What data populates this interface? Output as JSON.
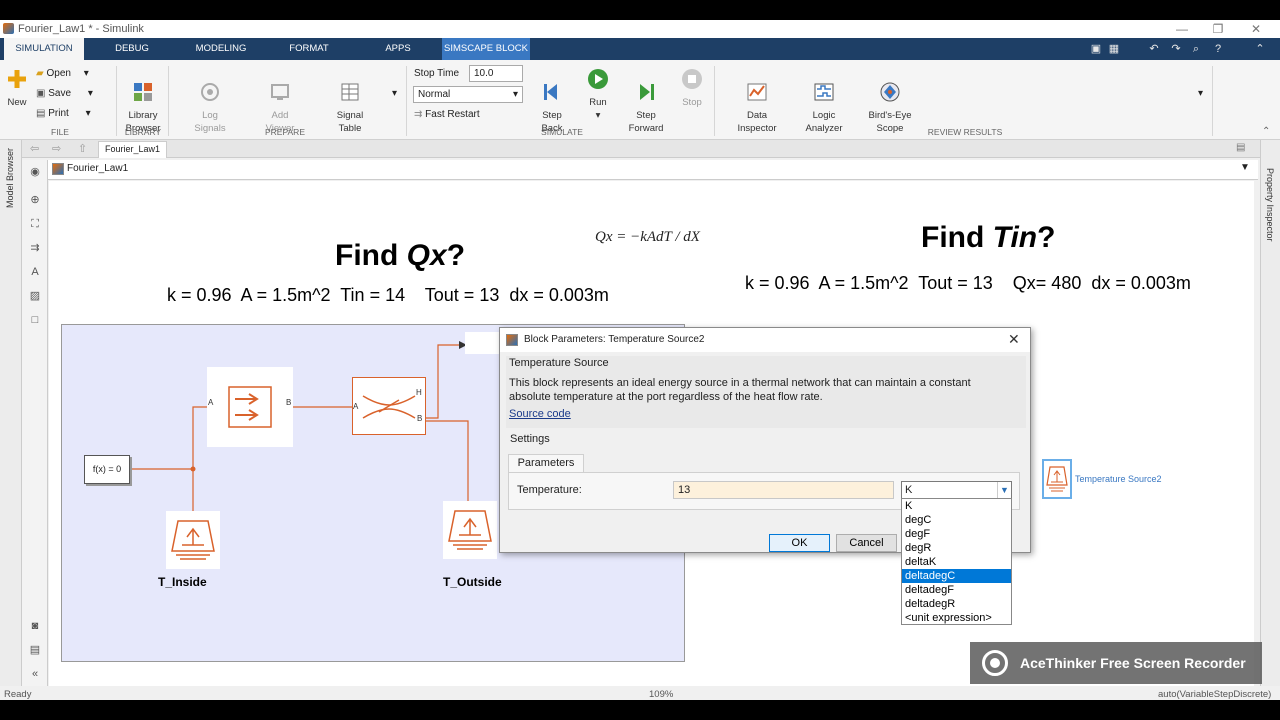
{
  "window": {
    "title": "Fourier_Law1 * - Simulink",
    "controls": [
      "—",
      "❐",
      "✕"
    ]
  },
  "ribbon_tabs": [
    "SIMULATION",
    "DEBUG",
    "MODELING",
    "FORMAT",
    "APPS",
    "SIMSCAPE BLOCK"
  ],
  "ribbon": {
    "file": {
      "title": "FILE",
      "new_label": "New",
      "open_label": "Open",
      "save_label": "Save",
      "print_label": "Print"
    },
    "library": {
      "title": "LIBRARY",
      "library_browser_label": "Library\nBrowser"
    },
    "prepare": {
      "title": "PREPARE",
      "log_signals_label": "Log\nSignals",
      "add_viewer_label": "Add\nViewer",
      "signal_table_label": "Signal\nTable"
    },
    "simulate": {
      "title": "SIMULATE",
      "stop_time_label": "Stop Time",
      "stop_time_value": "10.0",
      "mode_value": "Normal",
      "fast_restart_label": "Fast Restart",
      "step_back_label": "Step\nBack",
      "run_label": "Run",
      "step_forward_label": "Step\nForward",
      "stop_label": "Stop"
    },
    "review": {
      "title": "REVIEW RESULTS",
      "data_inspector_label": "Data\nInspector",
      "logic_analyzer_label": "Logic\nAnalyzer",
      "birds_eye_label": "Bird's-Eye\nScope"
    }
  },
  "editor": {
    "tab_label": "Fourier_Law1",
    "address": "Fourier_Law1",
    "left_strip_label": "Model Browser",
    "right_strip_label": "Property Inspector"
  },
  "canvas": {
    "left_title_prefix": "Find ",
    "left_title_italic": "Qx",
    "left_title_suffix": "?",
    "left_params": "k = 0.96  A = 1.5m^2  Tin = 14    Tout = 13  dx = 0.003m",
    "equation": "Qx = −kAdT / dX",
    "right_title_prefix": "Find ",
    "right_title_italic": "Tin",
    "right_title_suffix": "?",
    "right_params": "k = 0.96  A = 1.5m^2  Tout = 13    Qx= 480  dx = 0.003m",
    "solver_block_label": "f(x) = 0",
    "t_inside_label": "T_Inside",
    "t_outside_label": "T_Outside",
    "temperature_source2_label": "Temperature Source2",
    "port_a": "A",
    "port_b": "B",
    "port_h": "H"
  },
  "dialog": {
    "title": "Block Parameters: Temperature Source2",
    "block_name": "Temperature Source",
    "description": "This block represents an ideal energy source in a thermal network that can maintain a constant absolute temperature at the port regardless of the heat flow rate.",
    "source_code_link": "Source code",
    "settings_label": "Settings",
    "parameters_tab": "Parameters",
    "temperature_label": "Temperature:",
    "temperature_value": "13",
    "unit_value": "K",
    "ok_label": "OK",
    "cancel_label": "Cancel"
  },
  "unit_options": [
    "K",
    "degC",
    "degF",
    "degR",
    "deltaK",
    "deltadegC",
    "deltadegF",
    "deltadegR",
    "<unit expression>"
  ],
  "unit_highlighted": "deltadegC",
  "status": {
    "left": "Ready",
    "zoom": "109%",
    "solver": "auto(VariableStepDiscrete)"
  },
  "recorder_label": "AceThinker Free Screen Recorder",
  "colors": {
    "ribbon_dark": "#1e3f66",
    "simscape_tab": "#3a78c2",
    "block_orange": "#d9622b",
    "selection_blue": "#0078d7",
    "area_fill": "#e6e8fb"
  }
}
